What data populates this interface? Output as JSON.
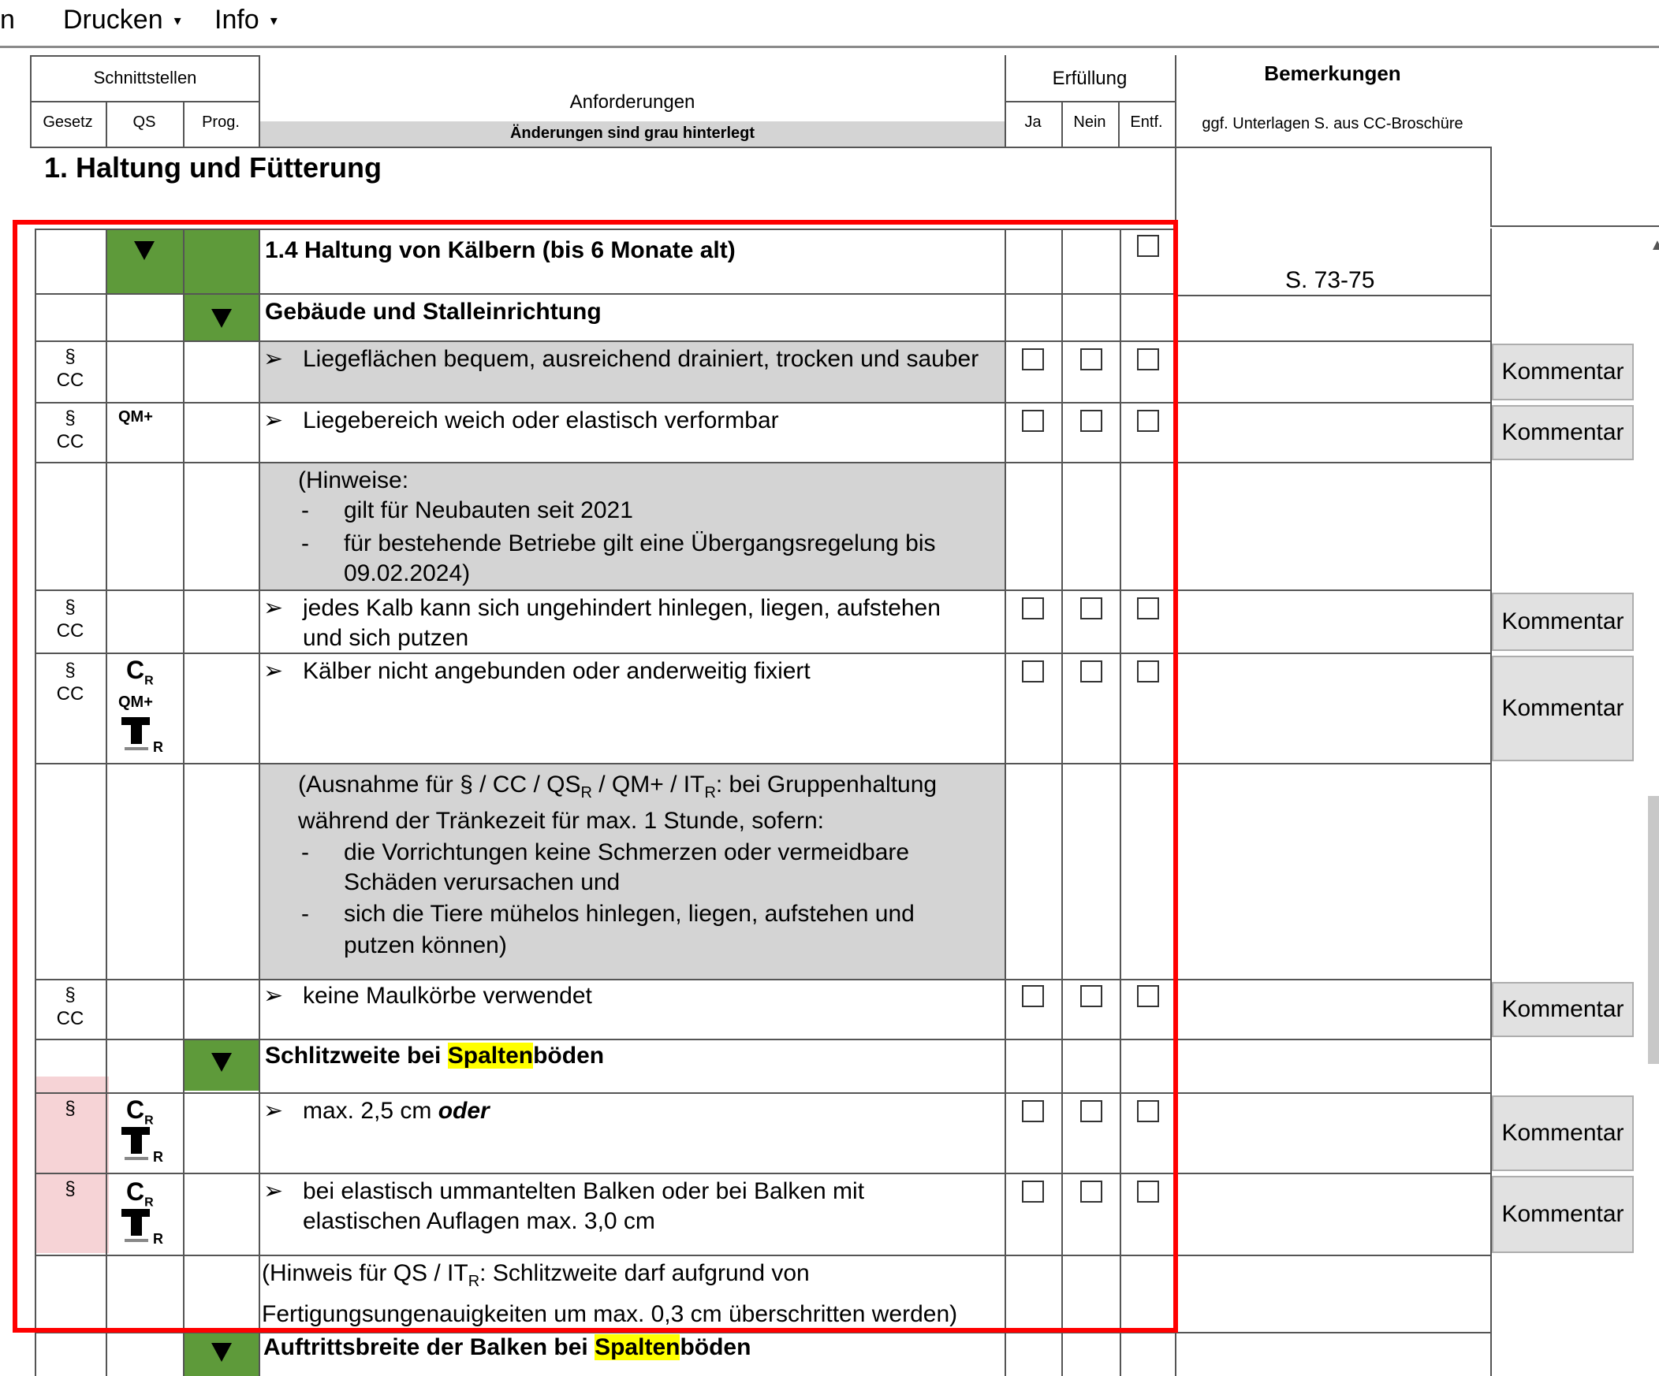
{
  "menu": {
    "partial": "n",
    "print": "Drucken",
    "info": "Info",
    "arrow": "▾"
  },
  "header": {
    "schnittstellen": "Schnittstellen",
    "gesetz": "Gesetz",
    "qs": "QS",
    "prog": "Prog.",
    "anforderungen": "Anforderungen",
    "aenderungen": "Änderungen sind grau hinterlegt",
    "erfuellung": "Erfüllung",
    "ja": "Ja",
    "nein": "Nein",
    "entf": "Entf.",
    "bemerkungen": "Bemerkungen",
    "unterlagen": "ggf. Unterlagen S. aus CC-Broschüre"
  },
  "section_title": "1. Haltung und Fütterung",
  "rows": {
    "r1_title": "1.4  Haltung von Kälbern (bis 6 Monate alt)",
    "r1_page": "S. 73-75",
    "r2_title": "Gebäude und Stalleinrichtung",
    "r3_text": "Liegeflächen bequem, ausreichend drainiert, trocken und sauber",
    "r4_text": "Liegebereich weich oder elastisch verformbar",
    "r5_l1": "(Hinweise:",
    "r5_l2": "gilt für Neubauten seit 2021",
    "r5_l3": "für bestehende Betriebe gilt eine Übergangsregelung bis",
    "r5_l4": "09.02.2024)",
    "r6_l1": "jedes Kalb kann sich ungehindert hinlegen, liegen, aufstehen",
    "r6_l2": "und sich putzen",
    "r7_text": "Kälber nicht angebunden oder anderweitig fixiert",
    "r8_l1a": "(Ausnahme für § / CC / QS",
    "r8_l1b": " / QM+ / IT",
    "r8_l1c": ": bei Gruppenhaltung",
    "r8_l2": "während der Tränkezeit für max. 1 Stunde, sofern:",
    "r8_l3": "die Vorrichtungen keine Schmerzen oder vermeidbare",
    "r8_l4": "Schäden verursachen und",
    "r8_l5": "sich die Tiere mühelos hinlegen, liegen, aufstehen und",
    "r8_l6": "putzen können)",
    "r9_text": "keine Maulkörbe verwendet",
    "r10_a": "Schlitzweite bei ",
    "r10_b": "Spalten",
    "r10_c": "böden",
    "r11_a": "max. 2,5 cm ",
    "r11_b": "oder",
    "r12_l1": "bei elastisch ummantelten Balken oder bei Balken mit",
    "r12_l2": "elastischen Auflagen max. 3,0 cm",
    "r13_l1a": "(Hinweis für QS / IT",
    "r13_l1b": ": Schlitzweite darf aufgrund von",
    "r13_l2": "Fertigungsungenauigkeiten um max. 0,3 cm überschritten werden)",
    "r14_a": "Auftrittsbreite der Balken bei ",
    "r14_b": "Spalten",
    "r14_c": "böden"
  },
  "labels": {
    "para": "§",
    "cc": "CC",
    "qmplus": "QM+",
    "sub_r": "R",
    "c_logo": "C",
    "bullet": "➢",
    "dash": "-"
  },
  "kommentar": "Kommentar"
}
